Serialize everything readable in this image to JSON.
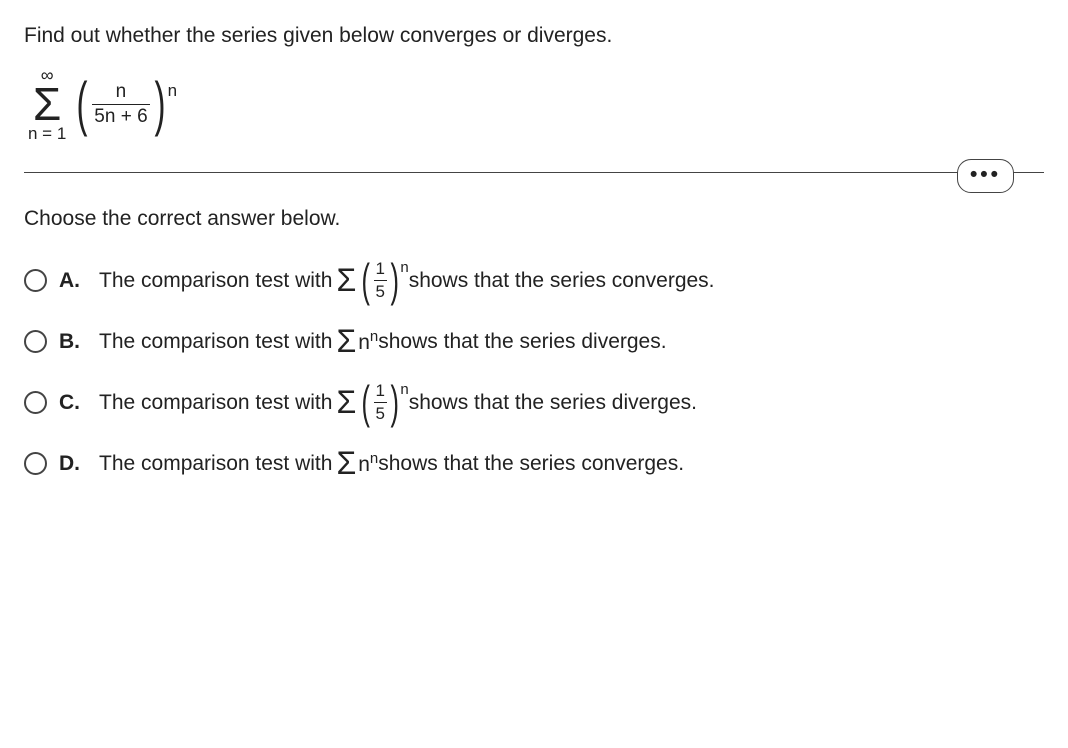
{
  "question": "Find out whether the series given below converges or diverges.",
  "series": {
    "sigma_top": "∞",
    "sigma_bottom": "n = 1",
    "frac_top": "n",
    "frac_bot": "5n + 6",
    "exp": "n"
  },
  "dots": "•••",
  "prompt": "Choose the correct answer below.",
  "options": {
    "A": {
      "letter": "A.",
      "pre": "The comparison test with ",
      "frac_top": "1",
      "frac_bot": "5",
      "exp": "n",
      "post": " shows that the series converges."
    },
    "B": {
      "letter": "B.",
      "pre": "The comparison test with ",
      "nn_base": "n",
      "nn_exp": "n",
      "post": " shows that the series diverges."
    },
    "C": {
      "letter": "C.",
      "pre": "The comparison test with ",
      "frac_top": "1",
      "frac_bot": "5",
      "exp": "n",
      "post": " shows that the series diverges."
    },
    "D": {
      "letter": "D.",
      "pre": "The comparison test with ",
      "nn_base": "n",
      "nn_exp": "n",
      "post": " shows that the series converges."
    }
  }
}
